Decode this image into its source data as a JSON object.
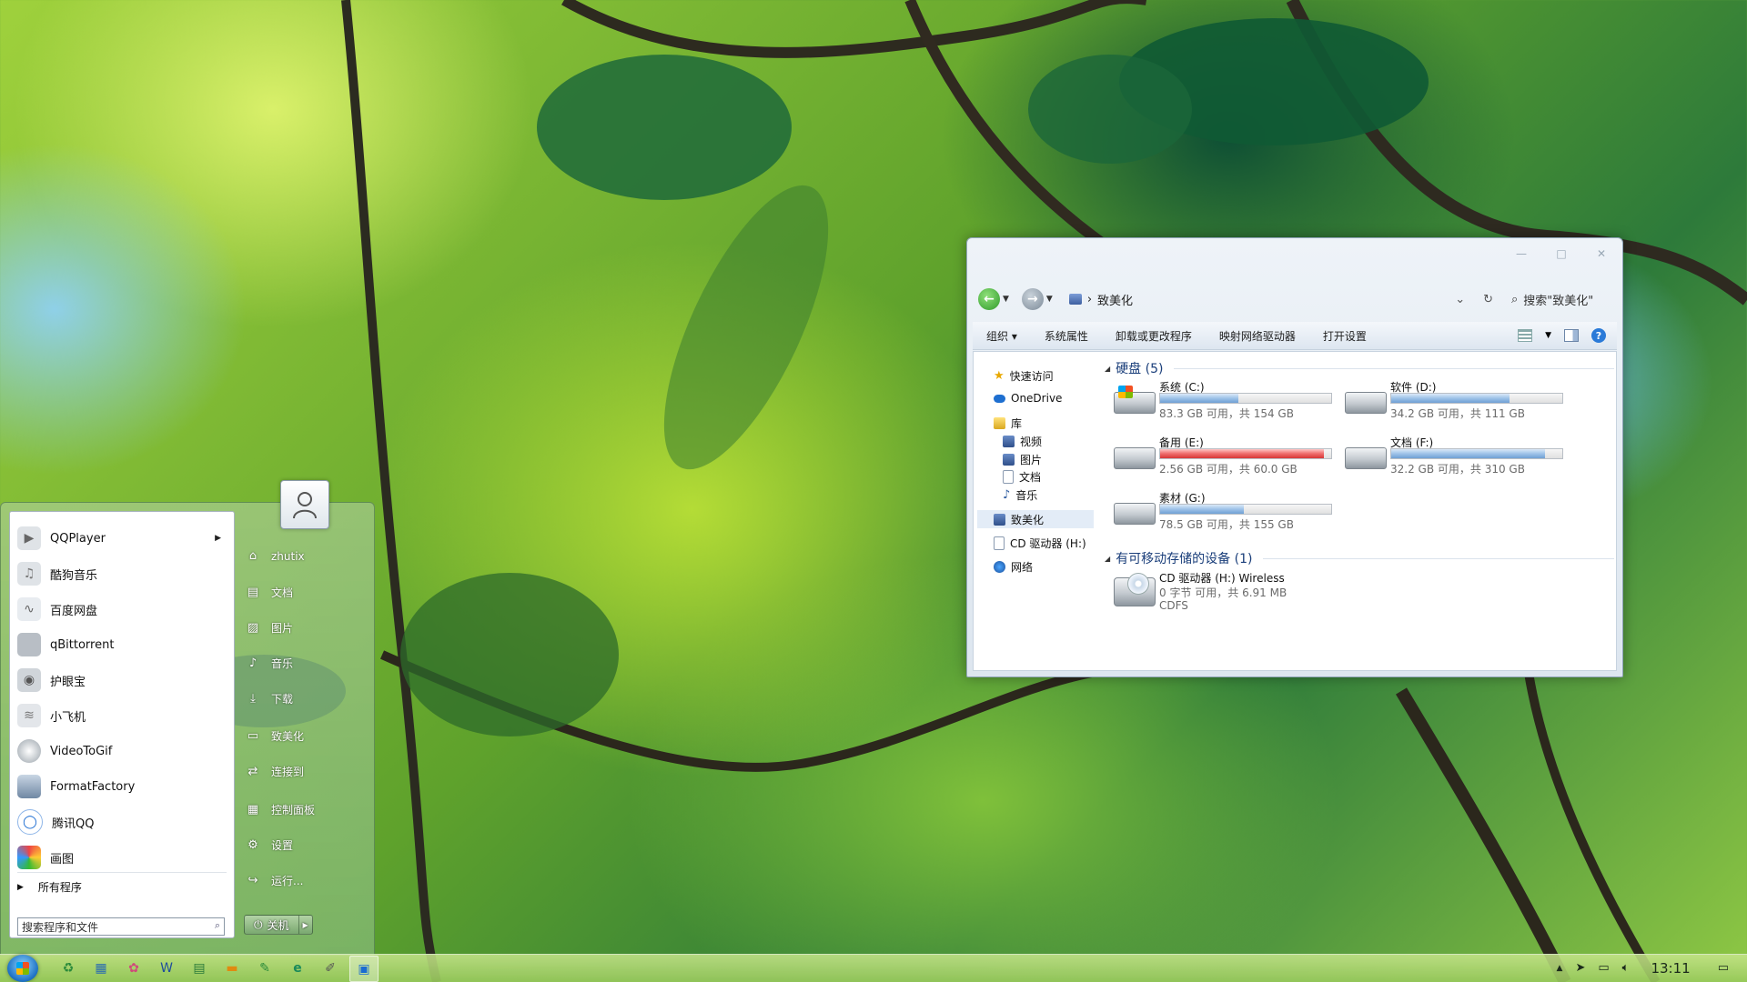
{
  "explorer": {
    "breadcrumb": "致美化",
    "search_placeholder": "搜索\"致美化\"",
    "controls": {
      "minimize": "—",
      "maximize": "□",
      "close": "✕"
    },
    "toolbar": [
      "组织 ▾",
      "系统属性",
      "卸载或更改程序",
      "映射网络驱动器",
      "打开设置"
    ],
    "nav": {
      "quick_access": "快速访问",
      "onedrive": "OneDrive",
      "libraries": "库",
      "videos": "视频",
      "pictures": "图片",
      "documents": "文档",
      "music": "音乐",
      "this_pc": "致美化",
      "cd_drive": "CD 驱动器 (H:)",
      "network": "网络"
    },
    "groups": {
      "hard_disks": "硬盘 (5)",
      "removable": "有可移动存储的设备 (1)"
    },
    "drives": [
      {
        "name": "系统 (C:)",
        "free": "83.3 GB 可用，共 154 GB",
        "used": 0.46,
        "type": "system"
      },
      {
        "name": "软件 (D:)",
        "free": "34.2 GB 可用，共 111 GB",
        "used": 0.69,
        "type": "disk"
      },
      {
        "name": "备用 (E:)",
        "free": "2.56 GB 可用，共 60.0 GB",
        "used": 0.96,
        "type": "disk"
      },
      {
        "name": "文档 (F:)",
        "free": "32.2 GB 可用，共 310 GB",
        "used": 0.9,
        "type": "disk"
      },
      {
        "name": "素材 (G:)",
        "free": "78.5 GB 可用，共 155 GB",
        "used": 0.49,
        "type": "disk"
      }
    ],
    "cd": {
      "name": "CD 驱动器 (H:) Wireless",
      "free": "0 字节 可用，共 6.91 MB",
      "fs": "CDFS"
    }
  },
  "start_menu": {
    "programs": [
      "QQPlayer",
      "酷狗音乐",
      "百度网盘",
      "qBittorrent",
      "护眼宝",
      "小飞机",
      "VideoToGif",
      "FormatFactory",
      "腾讯QQ",
      "画图"
    ],
    "all_programs": "所有程序",
    "search_placeholder": "搜索程序和文件",
    "right": [
      "zhutix",
      "文档",
      "图片",
      "音乐",
      "下载",
      "致美化",
      "连接到",
      "控制面板",
      "设置",
      "运行..."
    ],
    "shutdown": "关机"
  },
  "taskbar": {
    "time": "13:11"
  },
  "colors": {
    "bar_normal": "#6f9fd4",
    "bar_full": "#d83636",
    "accent": "#2a7ad8"
  }
}
